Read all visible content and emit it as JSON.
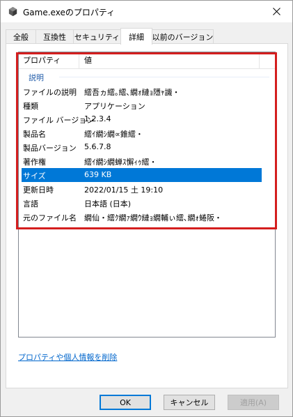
{
  "window": {
    "title": "Game.exeのプロパティ",
    "close_glyph": "✕"
  },
  "tabs": [
    {
      "label": "全般"
    },
    {
      "label": "互換性"
    },
    {
      "label": "セキュリティ"
    },
    {
      "label": "詳細"
    },
    {
      "label": "以前のバージョン"
    }
  ],
  "details": {
    "columns": {
      "property": "プロパティ",
      "value": "値"
    },
    "group_label": "説明",
    "rows": [
      {
        "name": "ファイルの説明",
        "value": "繧吾ヵ繧｡繧､繝ｫ縺ｮ隱ｬ譏・"
      },
      {
        "name": "種類",
        "value": "アプリケーション"
      },
      {
        "name": "ファイル バージョン",
        "value": "1.2.3.4"
      },
      {
        "name": "製品名",
        "value": "繧ｲ繝ｼ繝∝錐繧・"
      },
      {
        "name": "製品バージョン",
        "value": "5.6.7.8"
      },
      {
        "name": "著作権",
        "value": "繧ｲ繝ｼ繝蝉ｽ懈ｨｩ繧・"
      },
      {
        "name": "サイズ",
        "value": "639 KB"
      },
      {
        "name": "更新日時",
        "value": "2022/01/15 土 19:10"
      },
      {
        "name": "言語",
        "value": "日本語 (日本)"
      },
      {
        "name": "元のファイル名",
        "value": "繝仙・繧ｸ繝ｧ繝ｳ縺ｮ繝輔ぃ繧､繝ｫ蜷阪・"
      }
    ],
    "selected_row": "サイズ"
  },
  "remove_link": "プロパティや個人情報を削除",
  "buttons": {
    "ok": "OK",
    "cancel": "キャンセル",
    "apply": "適用(A)"
  },
  "colors": {
    "selection": "#0078d7",
    "highlight_border": "#d41e1e",
    "link": "#0066cc",
    "group_label": "#1e5aa8"
  }
}
